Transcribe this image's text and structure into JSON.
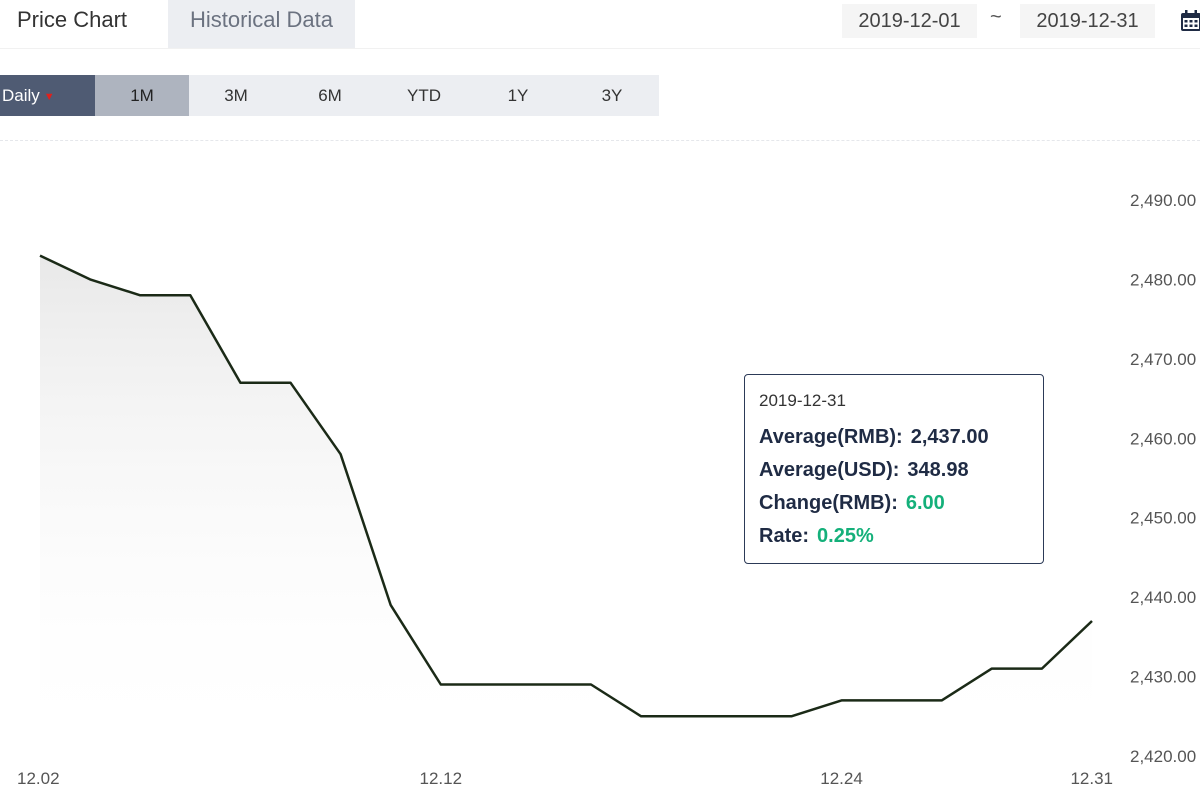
{
  "tabs": [
    {
      "label": "Price Chart",
      "active": true
    },
    {
      "label": "Historical Data",
      "active": false
    }
  ],
  "date_range": {
    "start": "2019-12-01",
    "separator": "~",
    "end": "2019-12-31"
  },
  "icons": {
    "calendar": "calendar-icon",
    "dropdown": "caret-down-icon"
  },
  "range_buttons": [
    {
      "label": "Daily",
      "style": "dropdown"
    },
    {
      "label": "1M",
      "selected": true
    },
    {
      "label": "3M"
    },
    {
      "label": "6M"
    },
    {
      "label": "YTD"
    },
    {
      "label": "1Y"
    },
    {
      "label": "3Y"
    }
  ],
  "tooltip": {
    "date": "2019-12-31",
    "rows": [
      {
        "label": "Average(RMB):",
        "value": "2,437.00",
        "color": "#1f2b44"
      },
      {
        "label": "Average(USD):",
        "value": "348.98",
        "color": "#1f2b44"
      },
      {
        "label": "Change(RMB):",
        "value": "6.00",
        "color": "#14b07a"
      },
      {
        "label": "Rate:",
        "value": "0.25%",
        "color": "#14b07a"
      }
    ]
  },
  "colors": {
    "line": "#1b2a17",
    "accent": "#4f5b73",
    "positive": "#14b07a"
  },
  "chart_data": {
    "type": "line",
    "x": [
      "12.02",
      "12.03",
      "12.04",
      "12.05",
      "12.06",
      "12.09",
      "12.10",
      "12.11",
      "12.12",
      "12.13",
      "12.16",
      "12.17",
      "12.18",
      "12.19",
      "12.20",
      "12.23",
      "12.24",
      "12.25",
      "12.26",
      "12.27",
      "12.30",
      "12.31"
    ],
    "series": [
      {
        "values": [
          2483,
          2480,
          2478,
          2478,
          2467,
          2467,
          2458,
          2439,
          2429,
          2429,
          2429,
          2429,
          2425,
          2425,
          2425,
          2425,
          2427,
          2427,
          2427,
          2431,
          2431,
          2437
        ]
      }
    ],
    "xtick_labels": [
      "12.02",
      "12.12",
      "12.24",
      "12.31"
    ],
    "ytick_labels": [
      "2,490.00",
      "2,480.00",
      "2,470.00",
      "2,460.00",
      "2,450.00",
      "2,440.00",
      "2,430.00",
      "2,420.00"
    ],
    "ylim": [
      2420,
      2490
    ],
    "grid": false
  }
}
